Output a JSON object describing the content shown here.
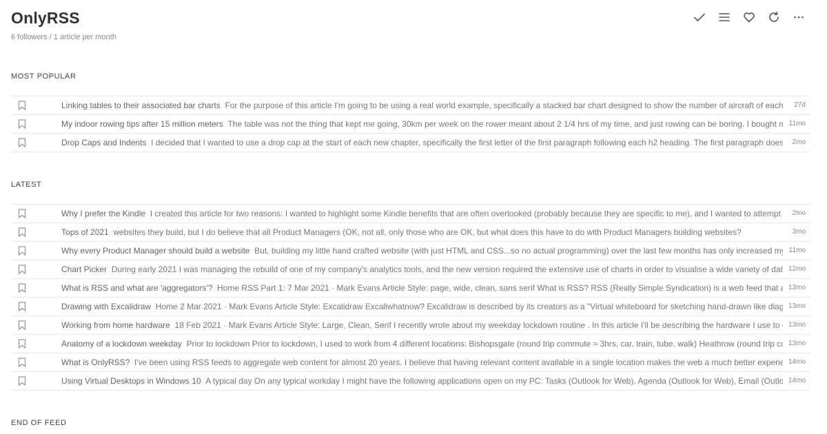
{
  "feed": {
    "title": "OnlyRSS",
    "subtitle": "6 followers / 1 article per month"
  },
  "toolbar": {
    "icons": [
      "check-icon",
      "menu-icon",
      "heart-icon",
      "refresh-icon",
      "more-icon"
    ]
  },
  "sections": {
    "popular_label": "MOST POPULAR",
    "latest_label": "LATEST",
    "end_label": "END OF FEED"
  },
  "popular": [
    {
      "title": "Linking tables to their associated bar charts",
      "excerpt": "For the purpose of this article I'm going to be using a real world example, specifically a stacked bar chart designed to show the number of aircraft of each type",
      "age": "27d"
    },
    {
      "title": "My indoor rowing tips after 15 million meters",
      "excerpt": "The table was not the thing that kept me going, 30km per week on the rower meant about 2 1/4 hrs of my time, and just rowing can be boring. I bought my C",
      "age": "11mo"
    },
    {
      "title": "Drop Caps and Indents",
      "excerpt": "I decided that I wanted to use a drop cap at the start of each new chapter, specifically the first letter of the first paragraph following each h2 heading. The first paragraph does star",
      "age": "2mo"
    }
  ],
  "latest": [
    {
      "title": "Why I prefer the Kindle",
      "excerpt": "I created this article for two reasons: I wanted to highlight some Kindle benefits that are often overlooked (probably because they are specific to me), and I wanted to attempt some",
      "age": "2mo"
    },
    {
      "title": "Tops of 2021",
      "excerpt": "websites they build, but I do believe that all Product Managers (OK, not all, only those who are OK, but what does this have to do with Product Managers building websites?",
      "age": "3mo"
    },
    {
      "title": "Why every Product Manager should build a website",
      "excerpt": "But, building my little hand crafted website (with just HTML and CSS...so no actual programming) over the last few months has only increased my ap",
      "age": "11mo"
    },
    {
      "title": "Chart Picker",
      "excerpt": "During early 2021 I was managing the rebuild of one of my company's analytics tools, and the new version required the extensive use of charts in order to visualise a wide variety of data, a",
      "age": "12mo"
    },
    {
      "title": "What is RSS and what are 'aggregators'?",
      "excerpt": "Home RSS Part 1: 7 Mar 2021 · Mark Evans Article Style: page, wide, clean, sans serif What is RSS? RSS (Really Simple Syndication) is a web feed that allov",
      "age": "13mo"
    },
    {
      "title": "Drawing with Excalidraw",
      "excerpt": "Home 2 Mar 2021 · Mark Evans Article Style: Excalidraw Excaliwhatnow? Excalidraw is described by its creators as a \"Virtual whiteboard for sketching hand-drawn like diagram",
      "age": "13mo"
    },
    {
      "title": "Working from home hardware",
      "excerpt": "18 Feb 2021 · Mark Evans Article Style: Large, Clean, Serif I recently wrote about my weekday lockdown routine . In this article I'll be describing the hardware I use to do m",
      "age": "13mo"
    },
    {
      "title": "Anatomy of a lockdown weekday",
      "excerpt": "Prior to lockdown Prior to lockdown, I used to work from 4 different locations: Bishopsgate (round trip commute ≈ 3hrs, car, train, tube, walk) Heathrow (round trip comm",
      "age": "13mo"
    },
    {
      "title": "What is OnlyRSS?",
      "excerpt": "I've been using RSS feeds to aggregate web content for almost 20 years. I believe that having relevant content available in a single location makes the web a much better experience",
      "age": "14mo"
    },
    {
      "title": "Using Virtual Desktops in Windows 10",
      "excerpt": "A typical day On any typical workday I might have the following applications open on my PC: Tasks (Outlook for Web), Agenda (Outlook for Web), Email (Outlook f",
      "age": "14mo"
    }
  ]
}
